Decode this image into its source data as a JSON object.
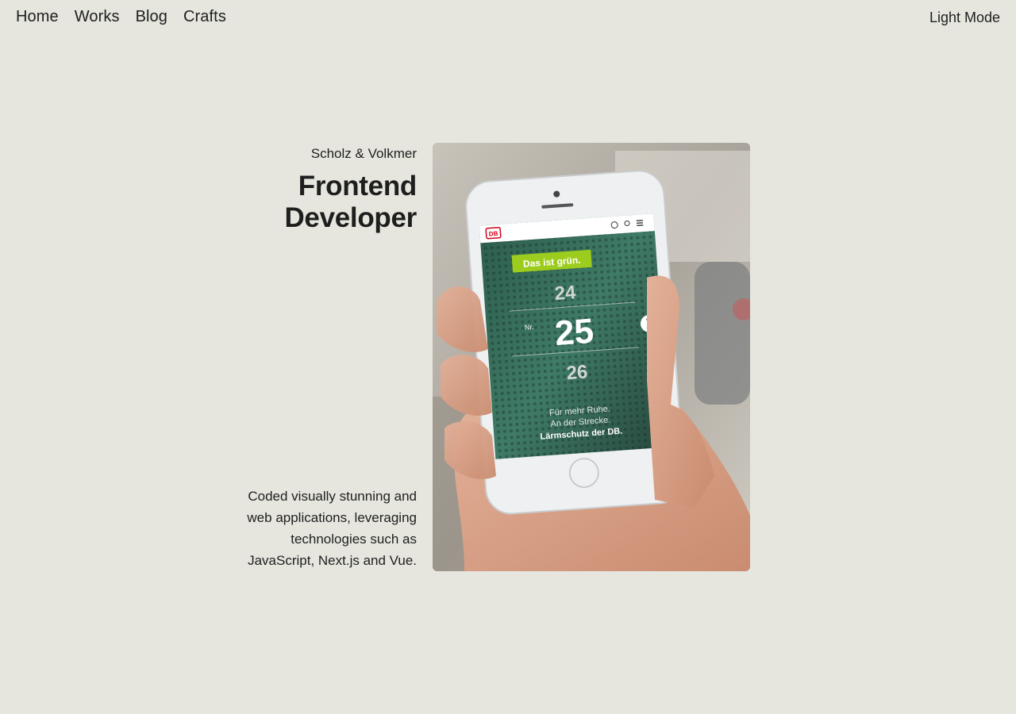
{
  "nav": {
    "links": [
      "Home",
      "Works",
      "Blog",
      "Crafts"
    ],
    "mode_toggle": "Light Mode"
  },
  "project": {
    "company": "Scholz & Volkmer",
    "role": "Frontend Developer",
    "description": "Coded visually stunning and web applications, leveraging technologies such as JavaScript, Next.js and Vue."
  },
  "screenshot": {
    "brand": "DB",
    "banner": "Das ist grün.",
    "numbers": [
      "24",
      "25",
      "26"
    ],
    "number_prefix": "Nr.",
    "tagline_1": "Für mehr Ruhe.",
    "tagline_2": "An der Strecke.",
    "tagline_3": "Lärmschutz der DB."
  }
}
